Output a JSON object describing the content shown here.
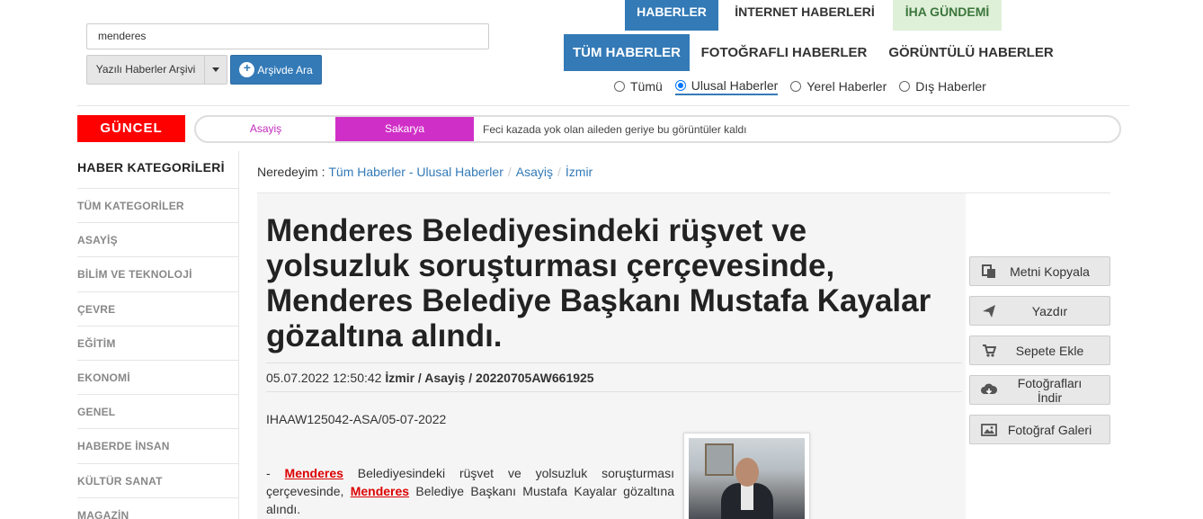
{
  "search": {
    "query": "menderes",
    "archive_select": "Yazılı Haberler Arşivi",
    "search_button": "Arşivde Ara"
  },
  "top_tabs": [
    "HABERLER",
    "İNTERNET HABERLERİ",
    "İHA GÜNDEMİ"
  ],
  "sub_tabs": [
    "TÜM HABERLER",
    "FOTOĞRAFLI HABERLER",
    "GÖRÜNTÜLÜ HABERLER"
  ],
  "scope_options": {
    "selected": "Ulusal Haberler",
    "items": [
      "Tümü",
      "Ulusal Haberler",
      "Yerel Haberler",
      "Dış Haberler"
    ]
  },
  "ticker": {
    "badge": "GÜNCEL",
    "category": "Asayiş",
    "city": "Sakarya",
    "headline": "Feci kazada yok olan aileden geriye bu görüntüler kaldı"
  },
  "sidebar": {
    "title": "HABER KATEGORİLERİ",
    "items": [
      "TÜM KATEGORİLER",
      "ASAYİŞ",
      "BİLİM VE TEKNOLOJİ",
      "ÇEVRE",
      "EĞİTİM",
      "EKONOMİ",
      "GENEL",
      "HABERDE İNSAN",
      "KÜLTÜR SANAT",
      "MAGAZİN"
    ]
  },
  "breadcrumb": {
    "prefix": "Neredeyim :",
    "items": [
      "Tüm Haberler - Ulusal Haberler",
      "Asayiş",
      "İzmir"
    ]
  },
  "article": {
    "title": "Menderes Belediyesindeki rüşvet ve yolsuzluk soruşturması çerçevesinde, Menderes Belediye Başkanı Mustafa Kayalar gözaltına alındı.",
    "meta_datetime": "05.07.2022 12:50:42",
    "meta_city": "İzmir",
    "meta_category": "Asayiş",
    "meta_id": "20220705AW661925",
    "code": "IHAAW125042-ASA/05-07-2022",
    "body_prefix": "- ",
    "body_kw1": "Menderes",
    "body_mid": " Belediyesindeki rüşvet ve yolsuzluk soruşturması çerçevesinde, ",
    "body_kw2": "Menderes",
    "body_end": " Belediye Başkanı Mustafa Kayalar gözaltına alındı."
  },
  "actions": [
    "Metni Kopyala",
    "Yazdır",
    "Sepete Ekle",
    "Fotoğrafları İndir",
    "Fotoğraf Galeri"
  ],
  "colors": {
    "primary": "#337ab7",
    "guncel_red": "#ff0000",
    "ticker_magenta": "#d02fc7",
    "iha_green_bg": "#dff0d8",
    "keyword_red": "#dd0000"
  }
}
